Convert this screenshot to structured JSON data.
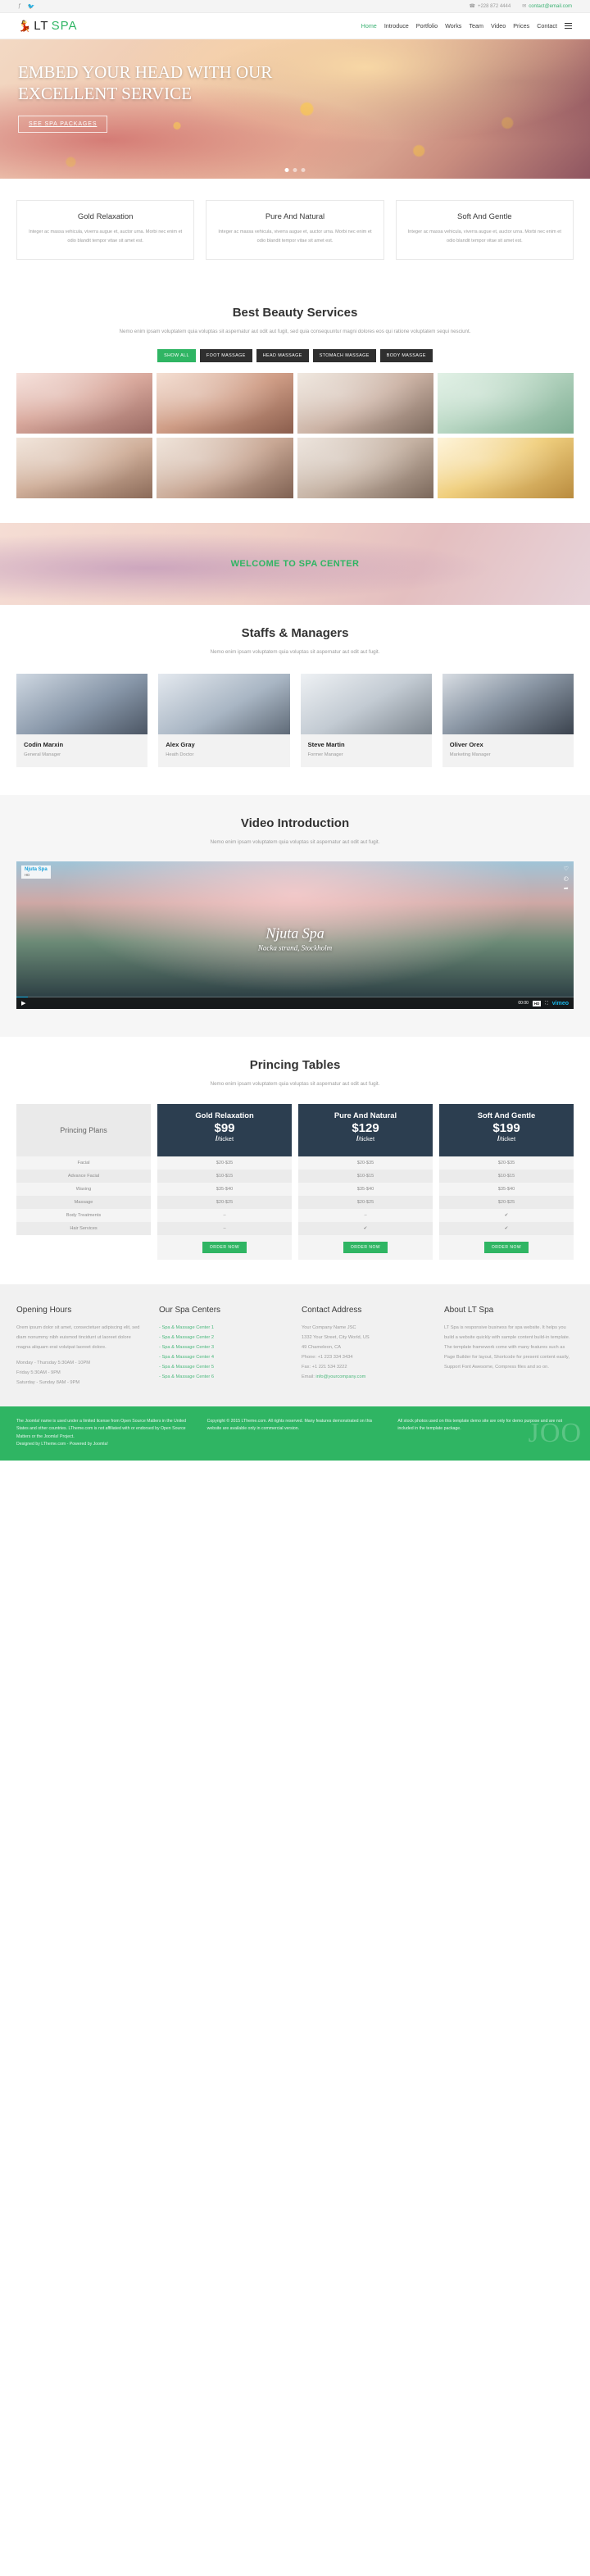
{
  "topbar": {
    "social": [
      "facebook-icon",
      "twitter-icon"
    ],
    "phone": "+228 872 4444",
    "email": "contact@email.com",
    "phone_icon": "phone-icon",
    "mail_icon": "mail-icon"
  },
  "header": {
    "logo_glyph": "spa-person-icon",
    "logo_lt": "LT",
    "logo_spa": "SPA",
    "nav": [
      {
        "label": "Home",
        "active": true
      },
      {
        "label": "Introduce",
        "active": false
      },
      {
        "label": "Portfolio",
        "active": false
      },
      {
        "label": "Works",
        "active": false
      },
      {
        "label": "Team",
        "active": false
      },
      {
        "label": "Video",
        "active": false
      },
      {
        "label": "Prices",
        "active": false
      },
      {
        "label": "Contact",
        "active": false
      }
    ],
    "menu_icon": "hamburger-icon"
  },
  "hero": {
    "title": "EMBED YOUR HEAD WITH OUR EXCELLENT SERVICE",
    "button": "SEE SPA PACKAGES"
  },
  "features": [
    {
      "title": "Gold Relaxation",
      "text": "Integer ac massa vehicula, viverra augue et, auctor urna. Morbi nec enim et odio blandit tempor vitae sit amet est."
    },
    {
      "title": "Pure And Natural",
      "text": "Integer ac massa vehicula, viverra augue et, auctor urna. Morbi nec enim et odio blandit tempor vitae sit amet est."
    },
    {
      "title": "Soft And Gentle",
      "text": "Integer ac massa vehicula, viverra augue et, auctor urna. Morbi nec enim et odio blandit tempor vitae sit amet est."
    }
  ],
  "services": {
    "title": "Best Beauty Services",
    "subtitle": "Nemo enim ipsam voluptatem quia voluptas sit aspernatur aut odit aut fugit, sed quia consequuntur magni dolores eos qui ratione voluptatem sequi nesciunt.",
    "filters": [
      {
        "label": "SHOW ALL",
        "active": true
      },
      {
        "label": "FOOT MASSAGE",
        "active": false
      },
      {
        "label": "HEAD MASSAGE",
        "active": false
      },
      {
        "label": "STOMACH MASSAGE",
        "active": false
      },
      {
        "label": "BODY MASSAGE",
        "active": false
      }
    ],
    "gallery": [
      {
        "name": "gallery-item-1"
      },
      {
        "name": "gallery-item-2"
      },
      {
        "name": "gallery-item-3"
      },
      {
        "name": "gallery-item-4"
      },
      {
        "name": "gallery-item-5"
      },
      {
        "name": "gallery-item-6"
      },
      {
        "name": "gallery-item-7"
      },
      {
        "name": "gallery-item-8"
      }
    ]
  },
  "welcome": {
    "title": "WELCOME TO SPA CENTER"
  },
  "staff": {
    "title": "Staffs & Managers",
    "subtitle": "Nemo enim ipsam voluptatem quia voluptas sit aspernatur aut odit aut fugit.",
    "members": [
      {
        "name": "Codin Marxin",
        "role": "General Manager"
      },
      {
        "name": "Alex Gray",
        "role": "Heath Doctor"
      },
      {
        "name": "Steve Martin",
        "role": "Former Manager"
      },
      {
        "name": "Oliver Orex",
        "role": "Marketing Manager"
      }
    ]
  },
  "video": {
    "title": "Video Introduction",
    "subtitle": "Nemo enim ipsam voluptatem quia voluptas sit aspernatur aut odit aut fugit.",
    "overlay_title": "Njuta Spa",
    "overlay_sub": "Nacka strand, Stockholm",
    "badge_title": "Njuta Spa",
    "badge_sub": "HD",
    "center_big": "Njuta Spa",
    "center_small": "Nacka strand, Stockholm",
    "play_icon": "play-icon",
    "time": "00:00",
    "hd": "HD",
    "brand": "vimeo",
    "like_icon": "heart-icon",
    "watch_icon": "clock-icon",
    "share_icon": "share-icon",
    "fullscreen_icon": "fullscreen-icon",
    "volume_icon": "volume-icon"
  },
  "pricing": {
    "title": "Princing Tables",
    "subtitle": "Nemo enim ipsam voluptatem quia voluptas sit aspernatur aut odit aut fugit.",
    "labels_header": "Princing Plans",
    "rows": [
      "Facial",
      "Advance Facial",
      "Waxing",
      "Massage",
      "Body Treatments",
      "Hair Services"
    ],
    "plans": [
      {
        "name": "Gold Relaxation",
        "price": "$99",
        "per": "/ticket",
        "values": [
          "$20-$35",
          "$10-$15",
          "$35-$40",
          "$20-$25",
          "–",
          "–"
        ],
        "order": "ORDER NOW"
      },
      {
        "name": "Pure And Natural",
        "price": "$129",
        "per": "/ticket",
        "values": [
          "$20-$35",
          "$10-$15",
          "$35-$40",
          "$20-$25",
          "–",
          "✔"
        ],
        "order": "ORDER NOW"
      },
      {
        "name": "Soft And Gentle",
        "price": "$199",
        "per": "/ticket",
        "values": [
          "$20-$35",
          "$10-$15",
          "$35-$40",
          "$20-$25",
          "✔",
          "✔"
        ],
        "order": "ORDER NOW"
      }
    ]
  },
  "footer": {
    "opening": {
      "title": "Opening Hours",
      "text": "Orem ipsum dolor sit amet, consectetuer adipiscing elit, sed diam nonummy nibh euismod tincidunt ut laoreet dolore magna aliquam erat volutpat laoreet dolore.",
      "line1": "Monday - Thursday 5:30AM - 10PM",
      "line2": "Friday 5:30AM - 9PM",
      "line3": "Saturday - Sunday 8AM - 9PM"
    },
    "centers": {
      "title": "Our Spa Centers",
      "items": [
        "- Spa & Massage Center 1",
        "- Spa & Massage Center 2",
        "- Spa & Massage Center 3",
        "- Spa & Massage Center 4",
        "- Spa & Massage Center 5",
        "- Spa & Massage Center 6"
      ]
    },
    "contact": {
      "title": "Contact Address",
      "company": "Your Company Name JSC",
      "street": "1332 Your Street, City World, US",
      "city": "49 Chameleon, CA",
      "phone": "Phone: +1 223 334 3434",
      "fax": "Fax: +1 221 534 3222",
      "email_label": "Email:",
      "email": "info@yourcompany.com"
    },
    "about": {
      "title": "About LT Spa",
      "text": "LT Spa is responsive business for spa website. It helps you build a website quickly with sample content build-in template. The template framework come with many features such as Page Builder for layout, Shortcode for present content easily, Support Font Awesome, Compress files and so on."
    }
  },
  "bottom": {
    "col1": "The Joomla! name is used under a limited license from Open Source Matters in the United States and other countries. LTheme.com is not affiliated with or endorsed by Open Source Matters or the Joomla! Project.",
    "col1b": "Designed by LTheme.com - Powered by Joomla!",
    "col2": "Copyright © 2015 LTheme.com. All rights reserved. Many features demonstrated on this website are available only in commercial version.",
    "col3": "All stock photos used on this template demo site are only for demo purpose and are not included in the template package.",
    "ghost": "JOO"
  }
}
